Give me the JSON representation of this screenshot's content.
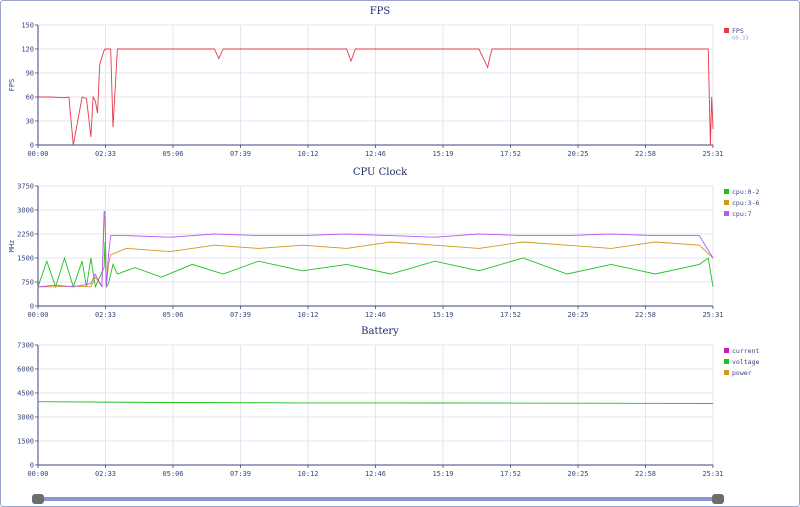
{
  "colors": {
    "axis": "#3a4680",
    "grid": "#e3e6f0",
    "fps": "#e8394b",
    "cpu_0_2": "#1ec21e",
    "cpu_3_6": "#d4961e",
    "cpu_7": "#b75af5",
    "current": "#c21eb4",
    "voltage": "#1ec21e",
    "power": "#d4961e",
    "slider_track": "#8a92d8",
    "slider_handle": "#6d6d6d"
  },
  "x_ticks": [
    "00:00",
    "02:33",
    "05:06",
    "07:39",
    "10:12",
    "12:46",
    "15:19",
    "17:52",
    "20:25",
    "22:58",
    "25:31"
  ],
  "chart_data": [
    {
      "type": "line",
      "title": "FPS",
      "ylabel": "FPS",
      "xlim_seconds": [
        0,
        1531
      ],
      "ylim": [
        0,
        150
      ],
      "y_ticks": [
        "0",
        "30",
        "60",
        "90",
        "120",
        "150"
      ],
      "legend_position": "right",
      "series": [
        {
          "name": "FPS",
          "sub_label": "60.33",
          "color": "#e8394b",
          "x_seconds": [
            0,
            30,
            60,
            70,
            80,
            100,
            110,
            120,
            125,
            130,
            135,
            140,
            145,
            150,
            152,
            153,
            160,
            165,
            170,
            180,
            200,
            300,
            400,
            410,
            420,
            500,
            600,
            700,
            710,
            720,
            800,
            1000,
            1020,
            1025,
            1030,
            1100,
            1200,
            1300,
            1400,
            1500,
            1520,
            1525,
            1528,
            1531
          ],
          "values": [
            60,
            60,
            59,
            60,
            0,
            60,
            58,
            10,
            60,
            55,
            40,
            100,
            110,
            118,
            120,
            120,
            120,
            120,
            22,
            120,
            120,
            120,
            120,
            108,
            120,
            120,
            120,
            120,
            105,
            120,
            120,
            120,
            97,
            110,
            120,
            120,
            120,
            120,
            120,
            120,
            120,
            0,
            60,
            20
          ]
        }
      ]
    },
    {
      "type": "line",
      "title": "CPU Clock",
      "ylabel": "MHz",
      "xlim_seconds": [
        0,
        1531
      ],
      "ylim": [
        0,
        3750
      ],
      "y_ticks": [
        "0",
        "750",
        "1500",
        "2250",
        "3000",
        "3750"
      ],
      "legend_position": "right",
      "series": [
        {
          "name": "cpu:0-2",
          "color": "#1ec21e",
          "x_seconds": [
            0,
            20,
            40,
            60,
            80,
            100,
            110,
            120,
            130,
            150,
            152,
            155,
            160,
            170,
            180,
            220,
            280,
            350,
            420,
            500,
            600,
            700,
            800,
            900,
            1000,
            1100,
            1200,
            1300,
            1400,
            1500,
            1520,
            1531
          ],
          "values": [
            600,
            1400,
            600,
            1500,
            600,
            1400,
            600,
            1500,
            600,
            1200,
            2000,
            600,
            700,
            1300,
            1000,
            1200,
            900,
            1300,
            1000,
            1400,
            1100,
            1300,
            1000,
            1400,
            1100,
            1500,
            1000,
            1300,
            1000,
            1300,
            1500,
            600
          ]
        },
        {
          "name": "cpu:3-6",
          "color": "#d4961e",
          "x_seconds": [
            0,
            40,
            80,
            120,
            130,
            145,
            150,
            152,
            155,
            160,
            165,
            200,
            300,
            400,
            500,
            600,
            700,
            800,
            900,
            1000,
            1100,
            1200,
            1300,
            1400,
            1500,
            1531
          ],
          "values": [
            600,
            600,
            620,
            600,
            900,
            600,
            2800,
            2800,
            600,
            1300,
            1600,
            1800,
            1700,
            1900,
            1800,
            1900,
            1800,
            2000,
            1900,
            1800,
            2000,
            1900,
            1800,
            2000,
            1900,
            1500
          ]
        },
        {
          "name": "cpu:7",
          "color": "#b75af5",
          "x_seconds": [
            0,
            40,
            80,
            120,
            130,
            145,
            150,
            152,
            155,
            160,
            165,
            200,
            300,
            400,
            500,
            600,
            700,
            800,
            900,
            1000,
            1100,
            1200,
            1300,
            1400,
            1500,
            1531
          ],
          "values": [
            600,
            650,
            600,
            700,
            1000,
            600,
            2950,
            2950,
            600,
            1600,
            2200,
            2200,
            2150,
            2250,
            2200,
            2200,
            2250,
            2200,
            2150,
            2250,
            2200,
            2200,
            2250,
            2200,
            2200,
            1500
          ]
        }
      ]
    },
    {
      "type": "line",
      "title": "Battery",
      "ylabel": "",
      "xlim_seconds": [
        0,
        1531
      ],
      "ylim": [
        0,
        7300
      ],
      "y_ticks": [
        "0",
        "1500",
        "3000",
        "4500",
        "6000",
        "7300"
      ],
      "legend_position": "right",
      "series": [
        {
          "name": "current",
          "color": "#c21eb4",
          "x_seconds": [],
          "values": []
        },
        {
          "name": "voltage",
          "color": "#1ec21e",
          "x_seconds": [
            0,
            300,
            600,
            900,
            1200,
            1531
          ],
          "values": [
            3850,
            3800,
            3780,
            3770,
            3760,
            3740
          ]
        },
        {
          "name": "power",
          "color": "#d4961e",
          "x_seconds": [],
          "values": []
        }
      ]
    }
  ]
}
